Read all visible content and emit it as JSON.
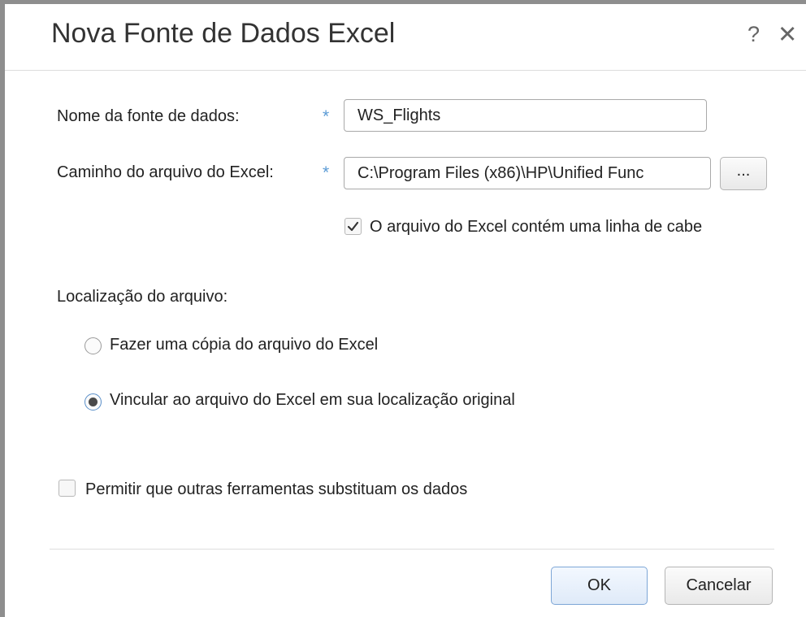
{
  "dialog": {
    "title": "Nova Fonte de Dados Excel",
    "help_glyph": "?",
    "close_glyph": "✕"
  },
  "form": {
    "name_label": "Nome da fonte de dados:",
    "name_value": "WS_Flights",
    "path_label": "Caminho do arquivo do Excel:",
    "path_value": "C:\\Program Files (x86)\\HP\\Unified Func",
    "browse_label": "...",
    "required_marker": "*",
    "header_row_label": "O arquivo do Excel contém uma linha de cabe",
    "header_row_checked": true
  },
  "location": {
    "section_label": "Localização do arquivo:",
    "option_copy": "Fazer uma cópia do arquivo do Excel",
    "option_link": "Vincular ao arquivo do Excel em sua localização original",
    "selected": "link"
  },
  "override": {
    "label": "Permitir que outras ferramentas substituam os dados",
    "checked": false
  },
  "buttons": {
    "ok": "OK",
    "cancel": "Cancelar"
  },
  "colors": {
    "required_star": "#5b9bd5",
    "ok_border": "#7da6d6"
  }
}
